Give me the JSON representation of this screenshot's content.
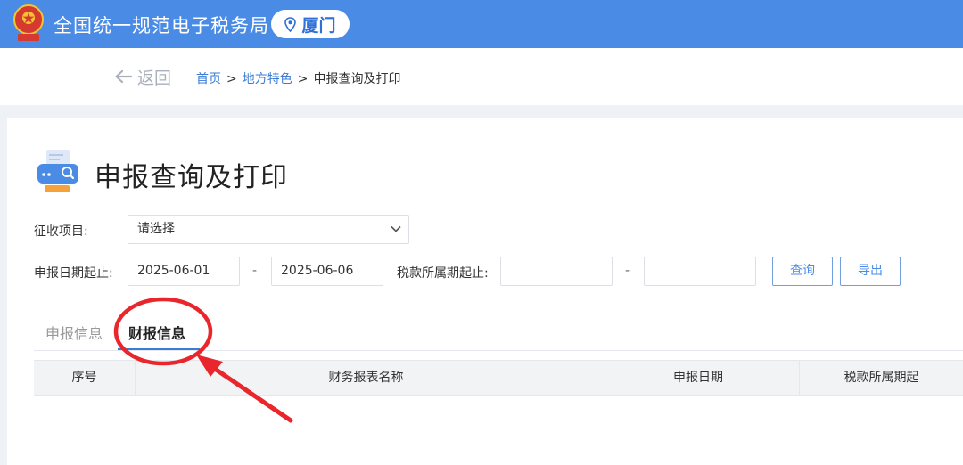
{
  "header": {
    "brand": "全国统一规范电子税务局",
    "city": "厦门",
    "emblem_icon": "national-tax-emblem-icon",
    "location_icon": "location-pin-icon"
  },
  "nav": {
    "back_label": "返回",
    "back_icon": "arrow-left-icon",
    "breadcrumb": {
      "home": "首页",
      "section": "地方特色",
      "current": "申报查询及打印",
      "separator": ">"
    }
  },
  "page": {
    "title": "申报查询及打印",
    "title_icon": "printer-search-icon"
  },
  "filters": {
    "levy_item": {
      "label": "征收项目:",
      "placeholder": "请选择",
      "chevron_icon": "chevron-down-icon"
    },
    "declare_date": {
      "label": "申报日期起止:",
      "start": "2025-06-01",
      "end": "2025-06-06",
      "separator": "-"
    },
    "tax_period": {
      "label": "税款所属期起止:",
      "start": "",
      "end": "",
      "separator": "-"
    },
    "query_button": "查询",
    "export_button": "导出"
  },
  "tabs": [
    {
      "label": "申报信息",
      "active": false
    },
    {
      "label": "财报信息",
      "active": true
    }
  ],
  "table": {
    "columns": [
      "序号",
      "财务报表名称",
      "申报日期",
      "税款所属期起"
    ]
  },
  "colors": {
    "header_bg": "#4a8be6",
    "accent": "#3a7bd5",
    "annotation": "#e8262b"
  }
}
